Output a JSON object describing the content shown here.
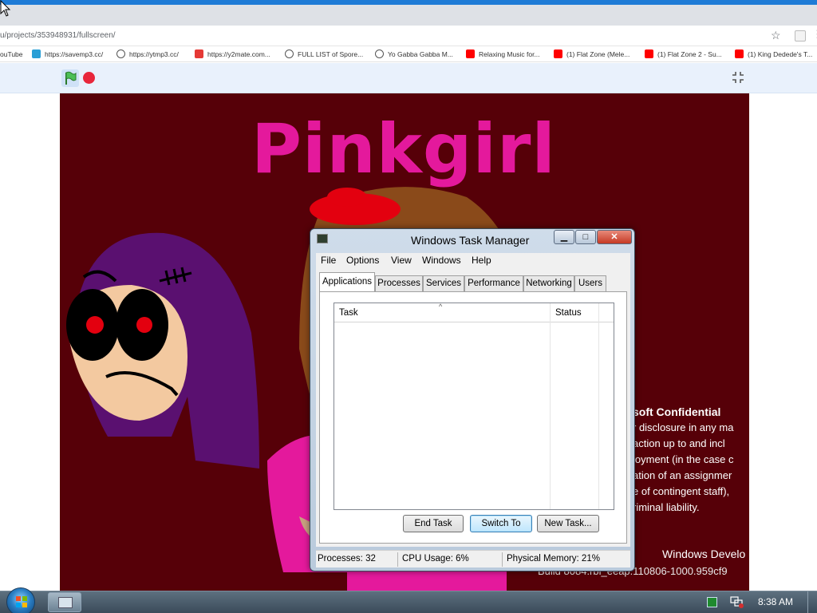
{
  "browser": {
    "url": "u/projects/353948931/fullscreen/",
    "bookmarks": [
      {
        "label": "ouTube",
        "icon": "youtube-icon",
        "color": "#ff0000"
      },
      {
        "label": "https://savemp3.cc/",
        "icon": "savemp3-icon",
        "color": "#2a9fd6"
      },
      {
        "label": "https://ytmp3.cc/",
        "icon": "ytmp3-icon",
        "color": "#3a3a3a"
      },
      {
        "label": "https://y2mate.com...",
        "icon": "y2mate-icon",
        "color": "#e53935"
      },
      {
        "label": "FULL LIST of Spore...",
        "icon": "globe-icon",
        "color": "#555555"
      },
      {
        "label": "Yo Gabba Gabba M...",
        "icon": "globe-icon",
        "color": "#555555"
      },
      {
        "label": "Relaxing Music for...",
        "icon": "youtube-icon",
        "color": "#ff0000"
      },
      {
        "label": "(1) Flat Zone (Mele...",
        "icon": "youtube-icon",
        "color": "#ff0000"
      },
      {
        "label": "(1) Flat Zone 2 - Su...",
        "icon": "youtube-icon",
        "color": "#ff0000"
      },
      {
        "label": "(1) King Dedede's T...",
        "icon": "youtube-icon",
        "color": "#ff0000"
      }
    ]
  },
  "stage": {
    "title": "Pinkgirl"
  },
  "background_text": {
    "conf_title": "soft Confidential",
    "lines": [
      "r disclosure in any ma",
      "action up to and incl",
      "loyment (in the case c",
      "ation of an assignmer",
      "e of contingent staff),",
      "riminal liability."
    ],
    "windows_version": "Windows Develo",
    "build": "Build 8084.rbl_eeap.110806-1000.959cf9"
  },
  "task_manager": {
    "title": "Windows Task Manager",
    "controls": {
      "minimize": "▁",
      "maximize": "□",
      "close": "✕"
    },
    "menu": [
      "File",
      "Options",
      "View",
      "Windows",
      "Help"
    ],
    "tabs": [
      "Applications",
      "Processes",
      "Services",
      "Performance",
      "Networking",
      "Users"
    ],
    "active_tab": "Applications",
    "columns": [
      "Task",
      "Status"
    ],
    "buttons": {
      "end_task": "End Task",
      "switch_to": "Switch To",
      "new_task": "New Task..."
    },
    "status": {
      "processes": "Processes: 32",
      "cpu": "CPU Usage: 6%",
      "memory": "Physical Memory: 21%"
    }
  },
  "taskbar": {
    "clock": "8:38 AM"
  },
  "colors": {
    "stage_bg": "#560008",
    "title_pink": "#e4199c"
  }
}
